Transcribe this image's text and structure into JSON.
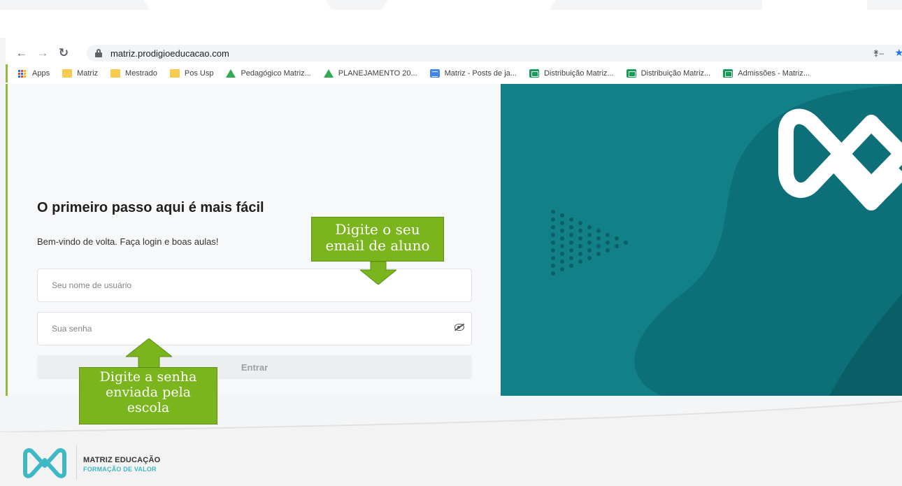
{
  "browser": {
    "url": "matriz.prodigioeducacao.com",
    "nav": {
      "back_icon": "arrow-left-icon",
      "forward_icon": "arrow-right-icon",
      "reload_icon": "reload-icon"
    },
    "bookmarks": [
      {
        "label": "Apps",
        "icon": "apps-grid-icon"
      },
      {
        "label": "Matriz",
        "icon": "folder-icon"
      },
      {
        "label": "Mestrado",
        "icon": "folder-icon"
      },
      {
        "label": "Pos Usp",
        "icon": "folder-icon"
      },
      {
        "label": "Pedagógico Matriz...",
        "icon": "google-drive-icon"
      },
      {
        "label": "PLANEJAMENTO 20...",
        "icon": "google-drive-icon"
      },
      {
        "label": "Matriz - Posts de ja...",
        "icon": "google-docs-icon"
      },
      {
        "label": "Distribuição Matriz...",
        "icon": "google-sheets-icon"
      },
      {
        "label": "Distribuição Matriz...",
        "icon": "google-sheets-icon"
      },
      {
        "label": "Admissões - Matriz...",
        "icon": "google-sheets-icon"
      }
    ]
  },
  "login": {
    "title": "O primeiro passo aqui é mais fácil",
    "subtitle": "Bem-vindo de volta. Faça login e boas aulas!",
    "username_placeholder": "Seu nome de usuário",
    "password_placeholder": "Sua senha",
    "submit_label": "Entrar"
  },
  "callouts": {
    "email_line1": "Digite o seu",
    "email_line2": "email de aluno",
    "password_line1": "Digite a senha",
    "password_line2": "enviada pela",
    "password_line3": "escola"
  },
  "footer": {
    "brand_name": "MATRIZ EDUCAÇÃO",
    "brand_tagline": "FORMAÇÃO DE VALOR"
  },
  "colors": {
    "teal": "#128087",
    "callout_green": "#7ab51d",
    "accent": "#3db8c4"
  }
}
